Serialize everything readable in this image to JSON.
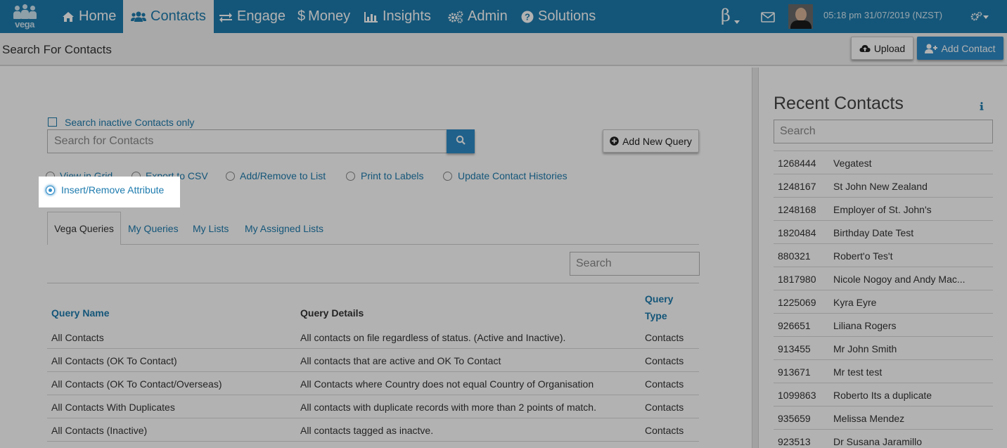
{
  "app": {
    "logo_text": "vega"
  },
  "nav": {
    "items": [
      {
        "label": "Home",
        "icon": "home-icon"
      },
      {
        "label": "Contacts",
        "icon": "users-icon",
        "active": true
      },
      {
        "label": "Engage",
        "icon": "exchange-icon"
      },
      {
        "label": "Money",
        "icon": "dollar-icon"
      },
      {
        "label": "Insights",
        "icon": "bar-chart-icon"
      },
      {
        "label": "Admin",
        "icon": "gears-icon"
      },
      {
        "label": "Solutions",
        "icon": "question-circle-icon"
      }
    ],
    "beta_label": "β",
    "datetime": "05:18 pm 31/07/2019 (NZST)"
  },
  "subheader": {
    "title": "Search For Contacts",
    "upload_label": "Upload",
    "add_contact_label": "Add Contact"
  },
  "search": {
    "inactive_label": "Search inactive Contacts only",
    "placeholder": "Search for Contacts",
    "add_query_label": "Add New Query"
  },
  "actions": [
    {
      "label": "View in Grid"
    },
    {
      "label": "Export to CSV"
    },
    {
      "label": "Add/Remove to List"
    },
    {
      "label": "Print to Labels"
    },
    {
      "label": "Update Contact Histories"
    },
    {
      "label": "Insert/Remove Attribute",
      "selected": true
    }
  ],
  "tabs": [
    {
      "label": "Vega Queries",
      "active": true
    },
    {
      "label": "My Queries"
    },
    {
      "label": "My Lists"
    },
    {
      "label": "My Assigned Lists"
    }
  ],
  "queries": {
    "search_placeholder": "Search",
    "headers": {
      "name": "Query Name",
      "details": "Query Details",
      "type_line1": "Query",
      "type_line2": "Type"
    },
    "rows": [
      {
        "name": "All Contacts",
        "details": "All contacts on file regardless of status. (Active and Inactive).",
        "type": "Contacts"
      },
      {
        "name": "All Contacts (OK To Contact)",
        "details": "All contacts that are active and OK To Contact",
        "type": "Contacts"
      },
      {
        "name": "All Contacts (OK To Contact/Overseas)",
        "details": "All Contacts where Country does not equal Country of Organisation",
        "type": "Contacts"
      },
      {
        "name": "All Contacts With Duplicates",
        "details": "All contacts with duplicate records with more than 2 points of match.",
        "type": "Contacts"
      },
      {
        "name": "All Contacts (Inactive)",
        "details": "All contacts tagged as inactve.",
        "type": "Contacts"
      }
    ]
  },
  "recent": {
    "title": "Recent Contacts",
    "search_placeholder": "Search",
    "rows": [
      {
        "id": "1268444",
        "name": "Vegatest"
      },
      {
        "id": "1248167",
        "name": "St John New Zealand"
      },
      {
        "id": "1248168",
        "name": "Employer of St. John's"
      },
      {
        "id": "1820484",
        "name": "Birthday Date Test"
      },
      {
        "id": "880321",
        "name": "Robert'o Tes't"
      },
      {
        "id": "1817980",
        "name": "Nicole Nogoy and Andy Mac..."
      },
      {
        "id": "1225069",
        "name": "Kyra Eyre"
      },
      {
        "id": "926651",
        "name": "Liliana Rogers"
      },
      {
        "id": "913455",
        "name": "Mr John Smith"
      },
      {
        "id": "913671",
        "name": "Mr test test"
      },
      {
        "id": "1099863",
        "name": "Roberto Its a duplicate"
      },
      {
        "id": "935659",
        "name": "Melissa Mendez"
      },
      {
        "id": "923513",
        "name": "Dr Susana Jaramillo"
      }
    ]
  },
  "colors": {
    "brand": "#1d7bae",
    "button_blue": "#2e8bc7"
  }
}
